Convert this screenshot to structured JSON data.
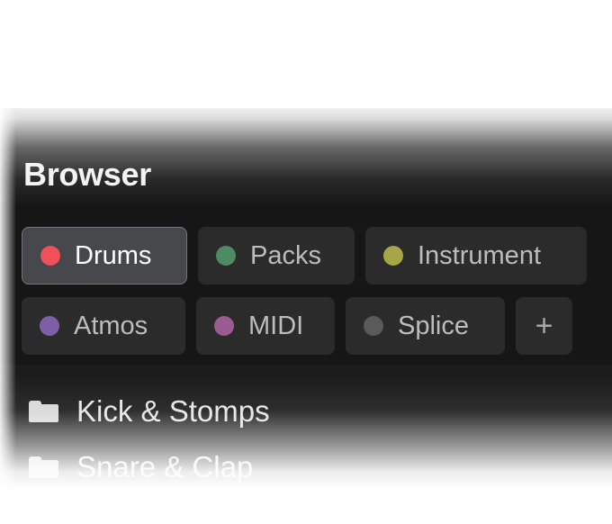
{
  "browser": {
    "title": "Browser",
    "tags": [
      {
        "label": "Drums",
        "color": "#f0505a",
        "selected": true
      },
      {
        "label": "Packs",
        "color": "#4e8a63",
        "selected": false
      },
      {
        "label": "Instrument",
        "color": "#a8a548",
        "selected": false
      },
      {
        "label": "Atmos",
        "color": "#7d5fa6",
        "selected": false
      },
      {
        "label": "MIDI",
        "color": "#9a5a92",
        "selected": false
      },
      {
        "label": "Splice",
        "color": "#5a5a5a",
        "selected": false
      }
    ],
    "add_label": "+",
    "folders": [
      {
        "label": "Kick & Stomps",
        "icon": "folder-icon"
      },
      {
        "label": "Snare & Clap",
        "icon": "folder-icon"
      }
    ]
  }
}
